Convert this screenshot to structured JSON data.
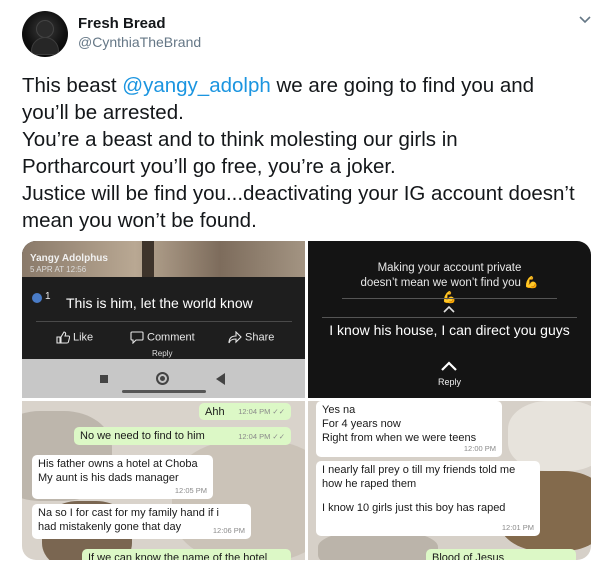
{
  "author": {
    "name": "Fresh Bread",
    "handle": "@CynthiaTheBrand"
  },
  "tweet": {
    "line1_prefix": "This beast ",
    "mention": "@yangy_adolph",
    "line1_suffix": " we are going to find you and",
    "line2": "you’ll be arrested.",
    "line3": "You’re a beast and to think molesting our girls in",
    "line4": "Portharcourt you’ll go free, you’re a joker.",
    "line5": "Justice will be find you...deactivating your IG account doesn’t",
    "line6": "mean you won’t be found."
  },
  "media": {
    "fb_post": {
      "user": "Yangy Adolphus",
      "date": "5 APR AT 12:56",
      "globe_count": "1",
      "message": "This is him, let the world know",
      "like_label": "Like",
      "comment_label": "Comment",
      "share_label": "Share",
      "reply_hint": "Reply"
    },
    "story_reply": {
      "message": "Making your account private doesn’t mean we won’t find you 💪💪",
      "reply_text": "I know his house, I can direct you guys",
      "reply_label": "Reply"
    },
    "chat_left": [
      {
        "type": "out",
        "text": "Ahh",
        "time": "12:04 PM ✓✓"
      },
      {
        "type": "out",
        "text": "No we need to find to him",
        "time": "12:04 PM ✓✓"
      },
      {
        "type": "in",
        "text": "His father owns a hotel at Choba",
        "text2": "My aunt is his dads manager",
        "time": "12:05 PM"
      },
      {
        "type": "in",
        "text": "Na so I for cast for my family hand if i",
        "text2": "had mistakenly gone that day",
        "time": "12:06 PM"
      },
      {
        "type": "out",
        "text": "If we can know the name of the hotel",
        "time": ""
      }
    ],
    "chat_right": [
      {
        "type": "in",
        "text": "Yes na",
        "text2": "For 4 years now",
        "text3": "Right from when we were teens",
        "time": "12:00 PM"
      },
      {
        "type": "in",
        "text": "I nearly fall prey o till my friends told me",
        "text2": "how he raped them",
        "text3": "I know 10 girls just this boy has raped",
        "time": "12:01 PM"
      },
      {
        "type": "out",
        "text": "Blood of Jesus",
        "time": ""
      }
    ]
  },
  "colors": {
    "mention": "#1b95e0",
    "text": "#14171a",
    "secondary": "#657786",
    "chat_out": "#dcf8c6",
    "chat_in": "#ffffff"
  }
}
